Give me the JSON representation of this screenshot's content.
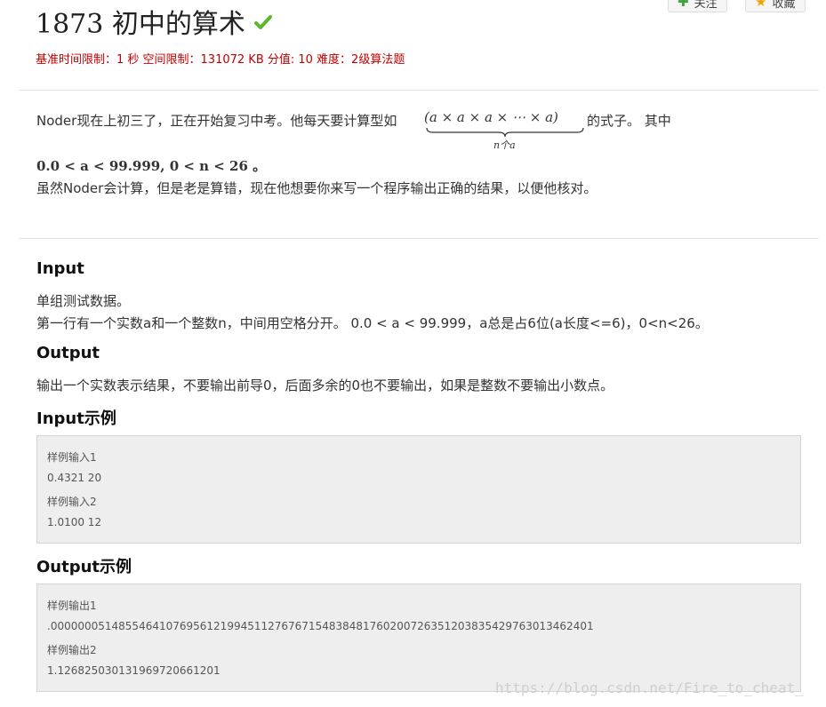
{
  "problem": {
    "title": "1873 初中的算术",
    "meta": "基准时间限制：1 秒 空间限制：131072 KB 分值: 10 难度：2级算法题",
    "follow_label": "关注",
    "favorite_label": "收藏"
  },
  "description": {
    "line1_prefix": "Noder现在上初三了，正在开始复习中考。他每天要计算型如",
    "formula": "(a ×  a ×  a ×   ⋯ ×  a)",
    "formula_brace_label": "n个a",
    "line1_suffix": "的式子。 其中",
    "constraint": "0.0 < a < 99.999, 0 < n < 26 。",
    "line3": "虽然Noder会计算，但是老是算错，现在他想要你来写一个程序输出正确的结果，以便他核对。"
  },
  "input_section": {
    "heading": "Input",
    "line1": "单组测试数据。",
    "line2": "第一行有一个实数a和一个整数n，中间用空格分开。 0.0 < a < 99.999，a总是占6位(a长度<=6)，0<n<26。"
  },
  "output_section": {
    "heading": "Output",
    "line1": "输出一个实数表示结果，不要输出前导0，后面多余的0也不要输出，如果是整数不要输出小数点。"
  },
  "input_example": {
    "heading": "Input示例",
    "lines": [
      "样例输入1",
      "0.4321 20",
      "样例输入2",
      "1.0100 12"
    ]
  },
  "output_example": {
    "heading": "Output示例",
    "lines": [
      "样例输出1",
      ".00000005148554641076956121994511276767154838481760200726351203835429763013462401",
      "样例输出2",
      "1.126825030131969720661201"
    ]
  },
  "watermark": "https://blog.csdn.net/Fire_to_cheat_",
  "colors": {
    "meta_red": "#c00000",
    "check_green": "#5cb82e",
    "sample_bg": "#eeeeee"
  },
  "icons": {
    "solved": "check-icon",
    "follow": "plus-icon",
    "favorite": "star-icon"
  }
}
